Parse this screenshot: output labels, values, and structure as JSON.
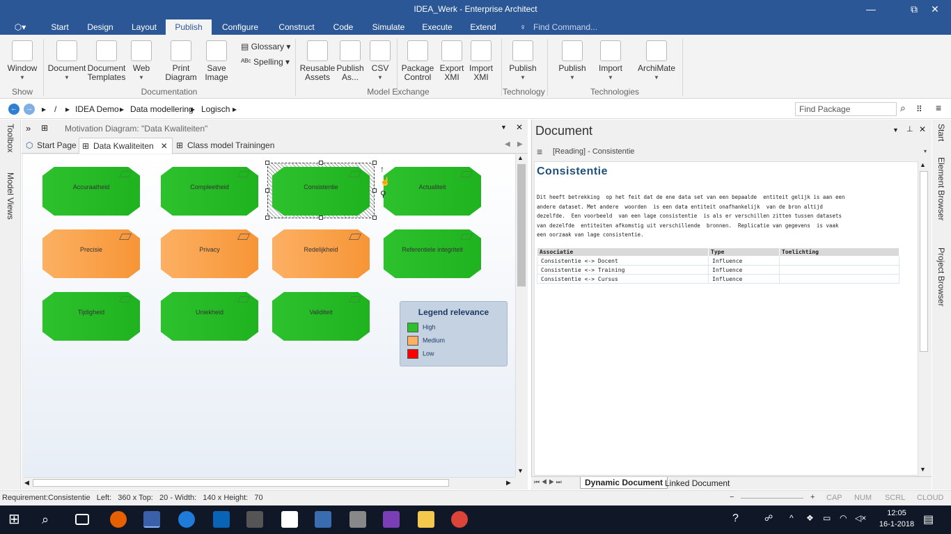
{
  "window": {
    "title": "IDEA_Werk - Enterprise Architect",
    "minimize": "—",
    "restore": "⧉",
    "close": "✕"
  },
  "menu": {
    "app_icon": "ea-logo-icon",
    "tabs": [
      "Start",
      "Design",
      "Layout",
      "Publish",
      "Configure",
      "Construct",
      "Code",
      "Simulate",
      "Execute",
      "Extend"
    ],
    "active": "Publish",
    "find_command": "Find Command..."
  },
  "ribbon": {
    "buttons": [
      {
        "label": "Window",
        "icon": "window-icon",
        "dropdown": true
      },
      {
        "label": "Document",
        "icon": "document-icon",
        "dropdown": true
      },
      {
        "label": "Document Templates",
        "icon": "document-templates-icon",
        "dropdown": false
      },
      {
        "label": "Web",
        "icon": "web-icon",
        "dropdown": true
      },
      {
        "label": "Print Diagram",
        "icon": "printer-icon",
        "dropdown": true
      },
      {
        "label": "Save Image",
        "icon": "save-image-icon",
        "dropdown": true
      },
      {
        "label": "Reusable Assets",
        "icon": "globe-icon",
        "dropdown": false
      },
      {
        "label": "Publish As...",
        "icon": "publish-as-icon",
        "dropdown": false
      },
      {
        "label": "CSV",
        "icon": "csv-icon",
        "dropdown": true
      },
      {
        "label": "Package Control",
        "icon": "package-control-icon",
        "dropdown": true
      },
      {
        "label": "Export XMI",
        "icon": "export-xmi-icon",
        "dropdown": true
      },
      {
        "label": "Import XMI",
        "icon": "import-xmi-icon",
        "dropdown": true
      },
      {
        "label": "Publish",
        "icon": "technology-publish-icon",
        "dropdown": true
      },
      {
        "label": "Publish",
        "icon": "publish-technology-icon",
        "dropdown": true
      },
      {
        "label": "Import",
        "icon": "import-technology-icon",
        "dropdown": true
      },
      {
        "label": "ArchiMate",
        "icon": "archimate-icon",
        "dropdown": true
      }
    ],
    "small_buttons": [
      {
        "label": "Glossary",
        "icon": "glossary-icon"
      },
      {
        "label": "Spelling",
        "icon": "spelling-icon"
      }
    ],
    "groups": [
      "Show",
      "Documentation",
      "Model Exchange",
      "Technology",
      "Technologies"
    ]
  },
  "navbar": {
    "back": "←",
    "forward": "→",
    "breadcrumb": [
      "/",
      "IDEA Demo",
      "Data modellering",
      "Logisch"
    ],
    "find_package": "Find Package"
  },
  "left_strip": [
    "Toolbox",
    "Model Views"
  ],
  "diagram": {
    "header": "Motivation Diagram: \"Data Kwaliteiten\"",
    "tabs": [
      {
        "label": "Start Page"
      },
      {
        "label": "Data Kwaliteiten",
        "closable": true
      },
      {
        "label": "Class model Trainingen"
      }
    ],
    "active_tab": "Data Kwaliteiten",
    "nodes": [
      {
        "label": "Accuraatheid",
        "relevance": "high"
      },
      {
        "label": "Compleetheid",
        "relevance": "high"
      },
      {
        "label": "Consistentie",
        "relevance": "high",
        "selected": true
      },
      {
        "label": "Actualiteit",
        "relevance": "high"
      },
      {
        "label": "Precisie",
        "relevance": "medium"
      },
      {
        "label": "Privacy",
        "relevance": "medium"
      },
      {
        "label": "Redelijkheid",
        "relevance": "medium"
      },
      {
        "label": "Referentiele integriteit",
        "relevance": "high"
      },
      {
        "label": "Tijdigheid",
        "relevance": "high"
      },
      {
        "label": "Uniekheid",
        "relevance": "high"
      },
      {
        "label": "Validiteit",
        "relevance": "high"
      }
    ],
    "legend": {
      "title": "Legend relevance",
      "items": [
        {
          "label": "High",
          "color": "#2dc22d"
        },
        {
          "label": "Medium",
          "color": "#fcb063"
        },
        {
          "label": "Low",
          "color": "#ff0000"
        }
      ]
    },
    "colors": {
      "high": "#2dc22d",
      "medium": "#f79536",
      "low": "#ff0000"
    }
  },
  "document": {
    "title": "Document",
    "subheader": "[Reading] - Consistentie",
    "heading": "Consistentie",
    "paragraph": "Dit heeft betrekking  op het feit dat de ene data set van een bepaalde  entiteit gelijk is aan een\nandere dataset. Met andere  woorden  is een data entiteit onafhankelijk  van de bron altijd\ndezelfde.  Een voorbeeld  van een lage consistentie  is als er verschillen zitten tussen datasets\nvan dezelfde  entiteiten afkomstig uit verschillende  bronnen.  Replicatie van gegevens  is vaak\neen oorzaak van lage consistentie.",
    "table": {
      "headers": [
        "Associatie",
        "Type",
        "Toelichting"
      ],
      "rows": [
        [
          "Consistentie  <-> Docent",
          "Influence",
          ""
        ],
        [
          "Consistentie  <-> Training",
          "Influence",
          ""
        ],
        [
          "Consistentie  <-> Cursus",
          "Influence",
          ""
        ]
      ]
    },
    "bottom_tabs": [
      "Dynamic Document",
      "Linked Document"
    ],
    "active_bottom_tab": "Dynamic Document"
  },
  "right_strip": [
    "Start",
    "Element Browser",
    "Project Browser"
  ],
  "status": {
    "text": "Requirement:Consistentie   Left:   360 x Top:   20 - Width:   140 x Height:   70",
    "zoom_minus": "−",
    "zoom_plus": "+",
    "indicators": [
      "CAP",
      "NUM",
      "SCRL",
      "CLOUD"
    ]
  },
  "taskbar": {
    "time": "12:05",
    "date": "16-1-2018"
  }
}
